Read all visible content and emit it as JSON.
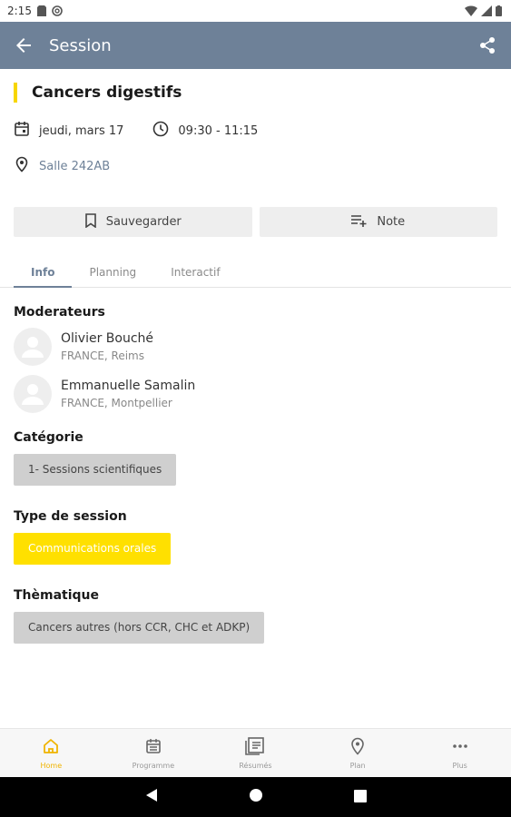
{
  "status_bar": {
    "time": "2:15"
  },
  "app_bar": {
    "title": "Session"
  },
  "session": {
    "title": "Cancers digestifs",
    "date": "jeudi, mars 17",
    "time_range": "09:30 - 11:15",
    "location": "Salle 242AB"
  },
  "actions": {
    "save_label": "Sauvegarder",
    "note_label": "Note"
  },
  "tabs": [
    {
      "label": "Info"
    },
    {
      "label": "Planning"
    },
    {
      "label": "Interactif"
    }
  ],
  "moderators": {
    "title": "Moderateurs",
    "items": [
      {
        "name": "Olivier Bouché",
        "country": "FRANCE, Reims"
      },
      {
        "name": "Emmanuelle Samalin",
        "country": "FRANCE, Montpellier"
      }
    ]
  },
  "category": {
    "title": "Catégorie",
    "value": "1- Sessions scientifiques"
  },
  "session_type": {
    "title": "Type de session",
    "value": "Communications orales"
  },
  "theme": {
    "title": "Thèmatique",
    "value": "Cancers autres (hors CCR, CHC et ADKP)"
  },
  "bottom_nav": [
    {
      "label": "Home",
      "icon": "home-icon"
    },
    {
      "label": "Programme",
      "icon": "calendar-icon"
    },
    {
      "label": "Résumés",
      "icon": "abstracts-icon"
    },
    {
      "label": "Plan",
      "icon": "map-pin-icon"
    },
    {
      "label": "Plus",
      "icon": "more-icon"
    }
  ],
  "colors": {
    "accent": "#f7d600",
    "app_bar": "#6e8198",
    "chip_yellow": "#ffe000",
    "active_nav": "#f0b400"
  }
}
